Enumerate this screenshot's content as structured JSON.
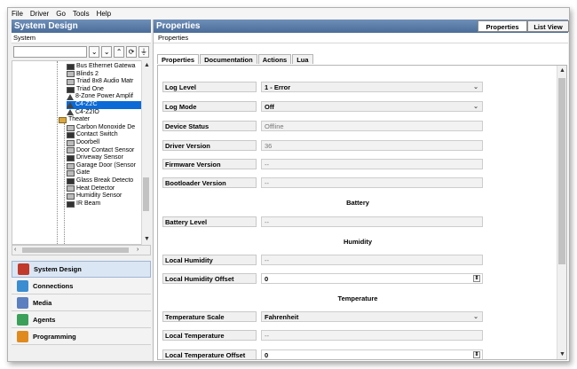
{
  "menu": [
    "File",
    "Driver",
    "Go",
    "Tools",
    "Help"
  ],
  "left_panel": {
    "title": "System Design",
    "system_label": "System",
    "tree": [
      {
        "label": "Bus Ethernet Gatewa",
        "icon": "device-icon",
        "depth": 1
      },
      {
        "label": "Blinds 2",
        "icon": "blinds-icon",
        "depth": 1
      },
      {
        "label": "Triad 8x8 Audio Matr",
        "icon": "audio-matrix-icon",
        "depth": 1
      },
      {
        "label": "Triad One",
        "icon": "speaker-icon",
        "depth": 1
      },
      {
        "label": "8-Zone Power Amplif",
        "icon": "amplifier-icon",
        "depth": 1
      },
      {
        "label": "C4-Z2C",
        "icon": "zigbee-icon",
        "depth": 1,
        "selected": true
      },
      {
        "label": "C4-Z2IO",
        "icon": "zigbee-icon",
        "depth": 1
      },
      {
        "label": "Theater",
        "icon": "room-icon",
        "depth": 0
      },
      {
        "label": "Carbon Monoxide De",
        "icon": "sensor-icon",
        "depth": 1
      },
      {
        "label": "Contact Switch",
        "icon": "switch-icon",
        "depth": 1
      },
      {
        "label": "Doorbell",
        "icon": "doorbell-icon",
        "depth": 1
      },
      {
        "label": "Door Contact Sensor",
        "icon": "sensor-icon",
        "depth": 1
      },
      {
        "label": "Driveway Sensor",
        "icon": "sensor-icon",
        "depth": 1
      },
      {
        "label": "Garage Door (Sensor",
        "icon": "garage-icon",
        "depth": 1
      },
      {
        "label": "Gate",
        "icon": "gate-icon",
        "depth": 1
      },
      {
        "label": "Glass Break Detecto",
        "icon": "sensor-icon",
        "depth": 1
      },
      {
        "label": "Heat Detector",
        "icon": "sensor-icon",
        "depth": 1
      },
      {
        "label": "Humidity Sensor",
        "icon": "sensor-icon",
        "depth": 1
      },
      {
        "label": "IR Beam",
        "icon": "sensor-icon",
        "depth": 1
      }
    ],
    "nav": [
      {
        "label": "System Design",
        "icon": "system-design-icon",
        "color": "#c0392b",
        "active": true
      },
      {
        "label": "Connections",
        "icon": "connections-icon",
        "color": "#3a8dd1",
        "active": false
      },
      {
        "label": "Media",
        "icon": "media-icon",
        "color": "#5b7fbf",
        "active": false
      },
      {
        "label": "Agents",
        "icon": "agents-icon",
        "color": "#3aa05a",
        "active": false
      },
      {
        "label": "Programming",
        "icon": "programming-icon",
        "color": "#e08a1e",
        "active": false
      }
    ]
  },
  "right_panel": {
    "title": "Properties",
    "view_tabs": [
      "Properties",
      "List View"
    ],
    "breadcrumb": "Properties",
    "sub_tabs": [
      "Properties",
      "Documentation",
      "Actions",
      "Lua"
    ],
    "rows": [
      {
        "label": "Log Level",
        "value": "1 - Error",
        "kind": "select"
      },
      {
        "label": "Log Mode",
        "value": "Off",
        "kind": "select"
      },
      {
        "label": "Device Status",
        "value": "Offline",
        "kind": "readonly"
      },
      {
        "label": "Driver Version",
        "value": "36",
        "kind": "readonly"
      },
      {
        "label": "Firmware Version",
        "value": "--",
        "kind": "readonly"
      },
      {
        "label": "Bootloader Version",
        "value": "--",
        "kind": "readonly"
      },
      {
        "section": "Battery"
      },
      {
        "label": "Battery Level",
        "value": "--",
        "kind": "readonly"
      },
      {
        "section": "Humidity"
      },
      {
        "label": "Local Humidity",
        "value": "--",
        "kind": "readonly"
      },
      {
        "label": "Local Humidity Offset",
        "value": "0",
        "kind": "spinner"
      },
      {
        "section": "Temperature"
      },
      {
        "label": "Temperature Scale",
        "value": "Fahrenheit",
        "kind": "select"
      },
      {
        "label": "Local Temperature",
        "value": "--",
        "kind": "readonly"
      },
      {
        "label": "Local Temperature Offset",
        "value": "0",
        "kind": "spinner"
      }
    ]
  }
}
